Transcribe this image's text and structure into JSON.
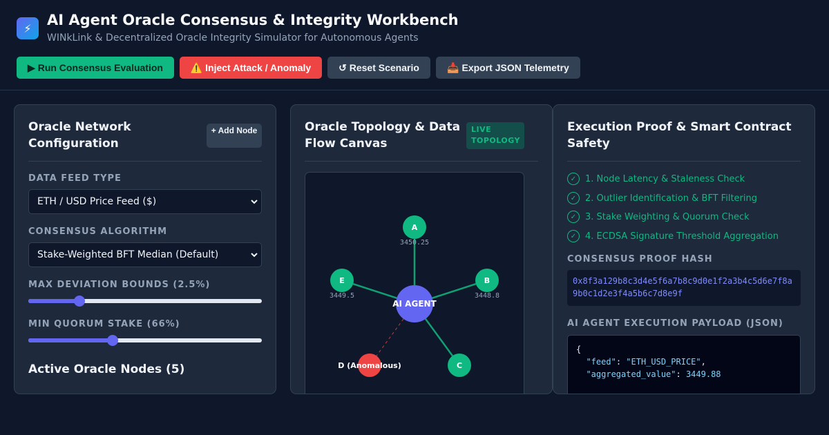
{
  "app": {
    "title": "AI Agent Oracle Consensus & Integrity Workbench",
    "subtitle": "WINkLink & Decentralized Oracle Integrity Simulator for Autonomous Agents",
    "logo_icon": "⚡"
  },
  "toolbar": {
    "run_label": "▶ Run Consensus Evaluation",
    "attack_label": "⚠️ Inject Attack / Anomaly",
    "reset_label": "↺ Reset Scenario",
    "export_label": "📥 Export JSON Telemetry"
  },
  "config": {
    "title": "Oracle Network Configuration",
    "add_node_label": "+ Add Node",
    "feed_label": "DATA FEED TYPE",
    "feed_value": "ETH / USD Price Feed ($)",
    "algo_label": "CONSENSUS ALGORITHM",
    "algo_value": "Stake-Weighted BFT Median (Default)",
    "deviation_label": "MAX DEVIATION BOUNDS (2.5%)",
    "deviation_fraction": 0.22,
    "quorum_label": "MIN QUORUM STAKE (66%)",
    "quorum_fraction": 0.36,
    "active_nodes_title": "Active Oracle Nodes (5)"
  },
  "topology": {
    "title": "Oracle Topology & Data Flow Canvas",
    "badge": "LIVE TOPOLOGY",
    "hub_label": "AI AGENT",
    "nodes": [
      {
        "id": "A",
        "label": "A",
        "value": "3450.25",
        "status": "ok"
      },
      {
        "id": "B",
        "label": "B",
        "value": "3448.8",
        "status": "ok"
      },
      {
        "id": "C",
        "label": "C",
        "value": "",
        "status": "ok"
      },
      {
        "id": "D",
        "label": "D (Anomalous)",
        "value": "",
        "status": "anomalous"
      },
      {
        "id": "E",
        "label": "E",
        "value": "3449.5",
        "status": "ok"
      }
    ]
  },
  "proof": {
    "title": "Execution Proof & Smart Contract Safety",
    "steps": [
      "1. Node Latency & Staleness Check",
      "2. Outlier Identification & BFT Filtering",
      "3. Stake Weighting & Quorum Check",
      "4. ECDSA Signature Threshold Aggregation"
    ],
    "hash_label": "CONSENSUS PROOF HASH",
    "hash_value": "0x8f3a129b8c3d4e5f6a7b8c9d0e1f2a3b4c5d6e7f8a9b0c1d2e3f4a5b6c7d8e9f",
    "payload_label": "AI AGENT EXECUTION PAYLOAD (JSON)",
    "payload_open": "{",
    "payload_feed_key": "\"feed\"",
    "payload_feed_value": "\"ETH_USD_PRICE\"",
    "payload_value_key": "\"aggregated_value\"",
    "payload_value_value": "3449.88"
  },
  "colors": {
    "ok": "#10b981",
    "anomalous": "#ef4444",
    "hub": "#6366f1"
  }
}
